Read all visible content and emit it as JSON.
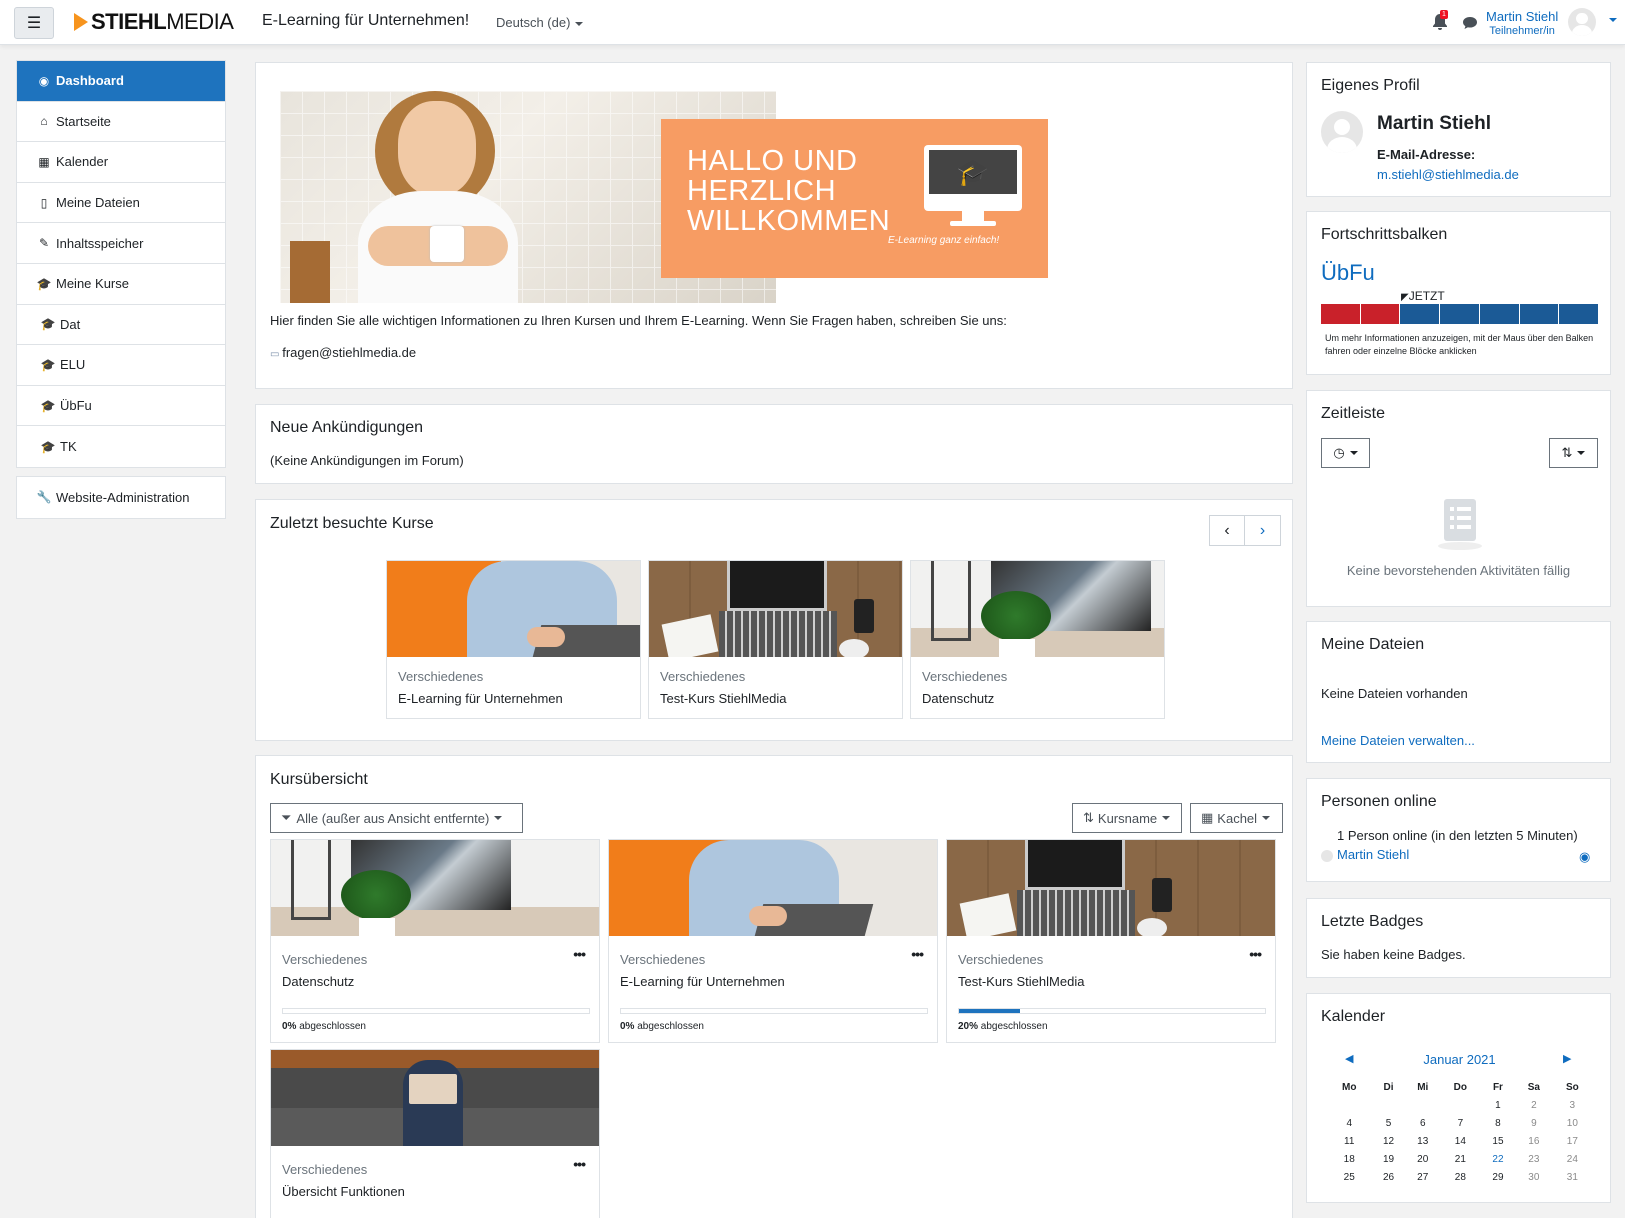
{
  "navbar": {
    "logo_bold": "STIEHL",
    "logo_light": "MEDIA",
    "site_name": "E-Learning für Unternehmen!",
    "language": "Deutsch (de)",
    "notification_count": "1",
    "user_name": "Martin Stiehl",
    "user_role": "Teilnehmer/in"
  },
  "leftnav": {
    "main": [
      {
        "label": "Dashboard",
        "icon": "dashboard-icon",
        "glyph": "◉",
        "active": true
      },
      {
        "label": "Startseite",
        "icon": "home-icon",
        "glyph": "⌂"
      },
      {
        "label": "Kalender",
        "icon": "calendar-icon",
        "glyph": "▦"
      },
      {
        "label": "Meine Dateien",
        "icon": "file-icon",
        "glyph": "▯"
      },
      {
        "label": "Inhaltsspeicher",
        "icon": "brush-icon",
        "glyph": "✎"
      },
      {
        "label": "Meine Kurse",
        "icon": "graduation-cap-icon",
        "glyph": "🎓"
      },
      {
        "label": "Dat",
        "icon": "graduation-cap-icon",
        "glyph": "🎓",
        "sub": true
      },
      {
        "label": "ELU",
        "icon": "graduation-cap-icon",
        "glyph": "🎓",
        "sub": true
      },
      {
        "label": "ÜbFu",
        "icon": "graduation-cap-icon",
        "glyph": "🎓",
        "sub": true
      },
      {
        "label": "TK",
        "icon": "graduation-cap-icon",
        "glyph": "🎓",
        "sub": true
      }
    ],
    "admin": {
      "label": "Website-Administration",
      "icon": "wrench-icon",
      "glyph": "🔧"
    }
  },
  "welcome": {
    "hello_line1": "HALLO UND",
    "hello_line2": "HERZLICH",
    "hello_line3": "WILLKOMMEN",
    "tagline": "E-Learning ganz einfach!",
    "text": "Hier finden Sie alle wichtigen Informationen zu Ihren Kursen und Ihrem E-Learning. Wenn Sie Fragen haben, schreiben Sie uns:",
    "email": "fragen@stiehlmedia.de"
  },
  "announcements": {
    "title": "Neue Ankündigungen",
    "empty": "(Keine Ankündigungen im Forum)"
  },
  "recent": {
    "title": "Zuletzt besuchte Kurse",
    "courses": [
      {
        "category": "Verschiedenes",
        "name": "E-Learning für Unternehmen"
      },
      {
        "category": "Verschiedenes",
        "name": "Test-Kurs StiehlMedia"
      },
      {
        "category": "Verschiedenes",
        "name": "Datenschutz"
      }
    ]
  },
  "overview": {
    "title": "Kursübersicht",
    "filter": "Alle (außer aus Ansicht entfernte)",
    "sort": "Kursname",
    "view": "Kachel",
    "courses": [
      {
        "category": "Verschiedenes",
        "name": "Datenschutz",
        "progress": 0,
        "pct_label": "0%",
        "pct_suffix": " abgeschlossen"
      },
      {
        "category": "Verschiedenes",
        "name": "E-Learning für Unternehmen",
        "progress": 0,
        "pct_label": "0%",
        "pct_suffix": " abgeschlossen"
      },
      {
        "category": "Verschiedenes",
        "name": "Test-Kurs StiehlMedia",
        "progress": 20,
        "pct_label": "20%",
        "pct_suffix": " abgeschlossen"
      },
      {
        "category": "Verschiedenes",
        "name": "Übersicht Funktionen"
      }
    ]
  },
  "profile": {
    "title": "Eigenes Profil",
    "name": "Martin Stiehl",
    "email_label": "E-Mail-Adresse:",
    "email": "m.stiehl@stiehlmedia.de"
  },
  "progress_block": {
    "title": "Fortschrittsbalken",
    "course": "ÜbFu",
    "now_label": "JETZT",
    "segments": [
      "red",
      "red",
      "blue",
      "blue",
      "blue",
      "blue",
      "blue"
    ],
    "colors": {
      "red": "#c9212a",
      "blue": "#1b5a96"
    },
    "help": "Um mehr Informationen anzuzeigen, mit der Maus über den Balken fahren oder einzelne Blöcke anklicken"
  },
  "timeline": {
    "title": "Zeitleiste",
    "empty": "Keine bevorstehenden Aktivitäten fällig"
  },
  "files": {
    "title": "Meine Dateien",
    "empty": "Keine Dateien vorhanden",
    "manage": "Meine Dateien verwalten..."
  },
  "online": {
    "title": "Personen online",
    "summary": "1 Person online (in den letzten 5 Minuten)",
    "user": "Martin Stiehl"
  },
  "badges": {
    "title": "Letzte Badges",
    "empty": "Sie haben keine Badges."
  },
  "calendar": {
    "title": "Kalender",
    "month": "Januar 2021",
    "weekdays": [
      "Mo",
      "Di",
      "Mi",
      "Do",
      "Fr",
      "Sa",
      "So"
    ],
    "weeks": [
      [
        "",
        "",
        "",
        "",
        "1",
        "2",
        "3"
      ],
      [
        "4",
        "5",
        "6",
        "7",
        "8",
        "9",
        "10"
      ],
      [
        "11",
        "12",
        "13",
        "14",
        "15",
        "16",
        "17"
      ],
      [
        "18",
        "19",
        "20",
        "21",
        "22",
        "23",
        "24"
      ],
      [
        "25",
        "26",
        "27",
        "28",
        "29",
        "30",
        "31"
      ]
    ],
    "today": "22"
  },
  "colors": {
    "primary": "#1e73be",
    "link": "#0f6cbf",
    "banner_orange": "#f79c63",
    "logo_orange": "#f7941d"
  }
}
